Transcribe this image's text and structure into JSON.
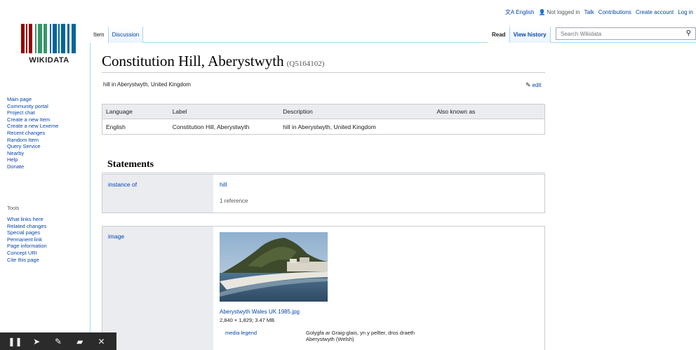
{
  "personal": {
    "language": "English",
    "not_logged": "Not logged in",
    "talk": "Talk",
    "contributions": "Contributions",
    "create_account": "Create account",
    "login": "Log in"
  },
  "logo": {
    "text": "WIKIDATA"
  },
  "nav": {
    "items": [
      "Main page",
      "Community portal",
      "Project chat",
      "Create a new Item",
      "Create a new Lexeme",
      "Recent changes",
      "Random Item",
      "Query Service",
      "Nearby",
      "Help",
      "Donate"
    ]
  },
  "tools": {
    "heading": "Tools",
    "items": [
      "What links here",
      "Related changes",
      "Special pages",
      "Permanent link",
      "Page information",
      "Concept URI",
      "Cite this page"
    ]
  },
  "tabs": {
    "item": "Item",
    "discussion": "Discussion",
    "read": "Read",
    "view_history": "View history"
  },
  "search": {
    "placeholder": "Search Wikidata"
  },
  "page": {
    "title": "Constitution Hill, Aberystwyth",
    "qid": "(Q5164102)",
    "description": "hill in Aberystwyth, United Kingdom",
    "edit": "edit"
  },
  "terms": {
    "headers": [
      "Language",
      "Label",
      "Description",
      "Also known as"
    ],
    "rows": [
      [
        "English",
        "Constitution Hill, Aberystwyth",
        "hill in Aberystwyth, United Kingdom",
        ""
      ]
    ]
  },
  "statements": {
    "heading": "Statements",
    "instance_of": {
      "property": "instance of",
      "value": "hill",
      "refs": "1 reference"
    },
    "image": {
      "property": "image",
      "file": "Aberystwyth Wales UK 1985.jpg",
      "size": "2,840 × 1,829; 3.47 MB",
      "qualifier_prop": "media legend",
      "qualifier_value": "Golygfa ar Graig-glais, yn y pellter, dros draeth Aberystwyth (Welsh)"
    }
  },
  "colors": {
    "link": "#0645ad",
    "tab_border": "#a7d7f9",
    "panel": "#eaecf0"
  }
}
